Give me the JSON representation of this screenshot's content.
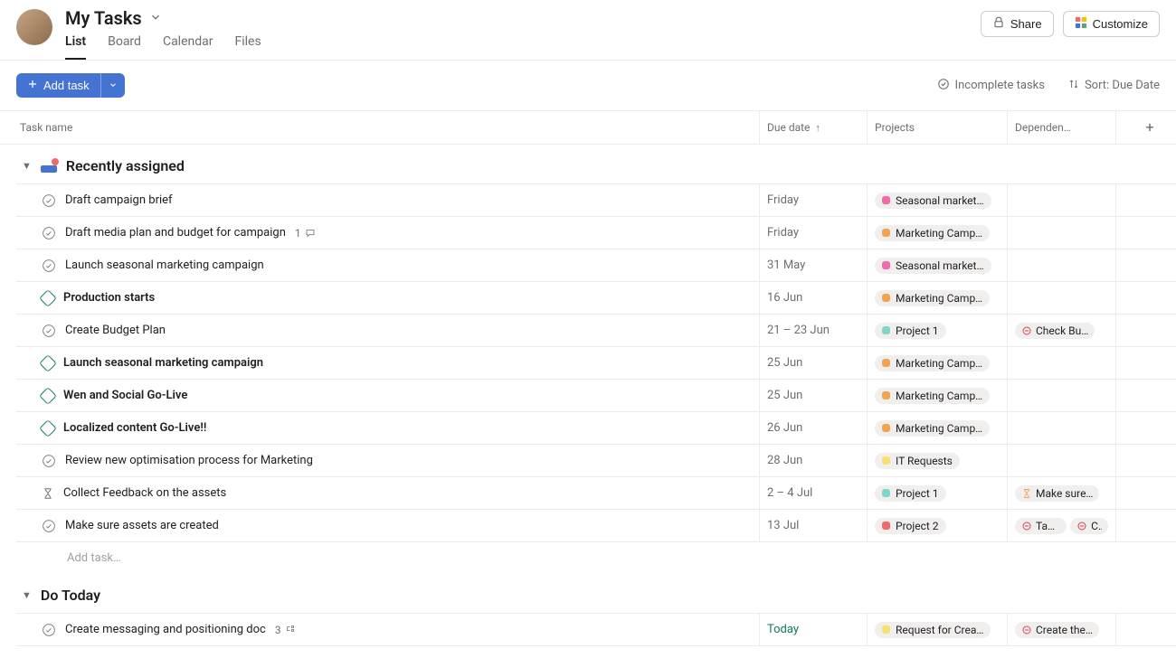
{
  "header": {
    "title": "My Tasks",
    "tabs": [
      "List",
      "Board",
      "Calendar",
      "Files"
    ],
    "active_tab": 0,
    "share_label": "Share",
    "customize_label": "Customize"
  },
  "toolbar": {
    "add_task_label": "Add task",
    "filter_label": "Incomplete tasks",
    "sort_label": "Sort: Due Date"
  },
  "columns": {
    "name": "Task name",
    "due": "Due date",
    "projects": "Projects",
    "dependencies": "Dependen…"
  },
  "sections": [
    {
      "id": "recent",
      "title": "Recently assigned",
      "show_inbox_icon": true,
      "tasks": [
        {
          "icon": "check",
          "name": "Draft campaign brief",
          "bold": false,
          "due": "Friday",
          "projects": [
            {
              "label": "Seasonal market…",
              "color": "c-pink"
            }
          ],
          "deps": []
        },
        {
          "icon": "check",
          "name": "Draft media plan and budget for campaign",
          "bold": false,
          "comments": "1",
          "due": "Friday",
          "projects": [
            {
              "label": "Marketing Camp…",
              "color": "c-orange"
            }
          ],
          "deps": []
        },
        {
          "icon": "check",
          "name": "Launch seasonal marketing campaign",
          "bold": false,
          "due": "31 May",
          "projects": [
            {
              "label": "Seasonal market…",
              "color": "c-pink"
            }
          ],
          "deps": []
        },
        {
          "icon": "milestone",
          "name": "Production starts",
          "bold": true,
          "due": "16 Jun",
          "projects": [
            {
              "label": "Marketing Camp…",
              "color": "c-orange"
            }
          ],
          "deps": []
        },
        {
          "icon": "check",
          "name": "Create Budget Plan",
          "bold": false,
          "due": "21 – 23 Jun",
          "projects": [
            {
              "label": "Project 1",
              "color": "c-teal"
            }
          ],
          "deps": [
            {
              "type": "block",
              "label": "Check Bu…"
            }
          ]
        },
        {
          "icon": "milestone",
          "name": "Launch seasonal marketing campaign",
          "bold": true,
          "due": "25 Jun",
          "projects": [
            {
              "label": "Marketing Camp…",
              "color": "c-orange"
            }
          ],
          "deps": []
        },
        {
          "icon": "milestone",
          "name": "Wen and Social Go-Live",
          "bold": true,
          "due": "25 Jun",
          "projects": [
            {
              "label": "Marketing Camp…",
              "color": "c-orange"
            }
          ],
          "deps": []
        },
        {
          "icon": "milestone",
          "name": "Localized content Go-Live!!",
          "bold": true,
          "due": "26 Jun",
          "projects": [
            {
              "label": "Marketing Camp…",
              "color": "c-orange"
            }
          ],
          "deps": []
        },
        {
          "icon": "check",
          "name": "Review new optimisation process for Marketing",
          "bold": false,
          "due": "28 Jun",
          "projects": [
            {
              "label": "IT Requests",
              "color": "c-yellow"
            }
          ],
          "deps": []
        },
        {
          "icon": "hourglass",
          "name": "Collect Feedback on the assets",
          "bold": false,
          "due": "2 – 4 Jul",
          "projects": [
            {
              "label": "Project 1",
              "color": "c-teal"
            }
          ],
          "deps": [
            {
              "type": "wait",
              "label": "Make sure…"
            }
          ]
        },
        {
          "icon": "check",
          "name": "Make sure assets are created",
          "bold": false,
          "due": "13 Jul",
          "projects": [
            {
              "label": "Project 2",
              "color": "c-salmon"
            }
          ],
          "deps": [
            {
              "type": "block",
              "label": "Task…"
            },
            {
              "type": "block",
              "label": "C…"
            }
          ]
        }
      ],
      "add_task_placeholder": "Add task…"
    },
    {
      "id": "today",
      "title": "Do Today",
      "show_inbox_icon": false,
      "tasks": [
        {
          "icon": "check",
          "name": "Create messaging and positioning doc",
          "bold": false,
          "subtasks": "3",
          "due": "Today",
          "due_today": true,
          "projects": [
            {
              "label": "Request for Crea…",
              "color": "c-yellow"
            }
          ],
          "deps": [
            {
              "type": "block",
              "label": "Create the…"
            }
          ]
        }
      ]
    }
  ]
}
